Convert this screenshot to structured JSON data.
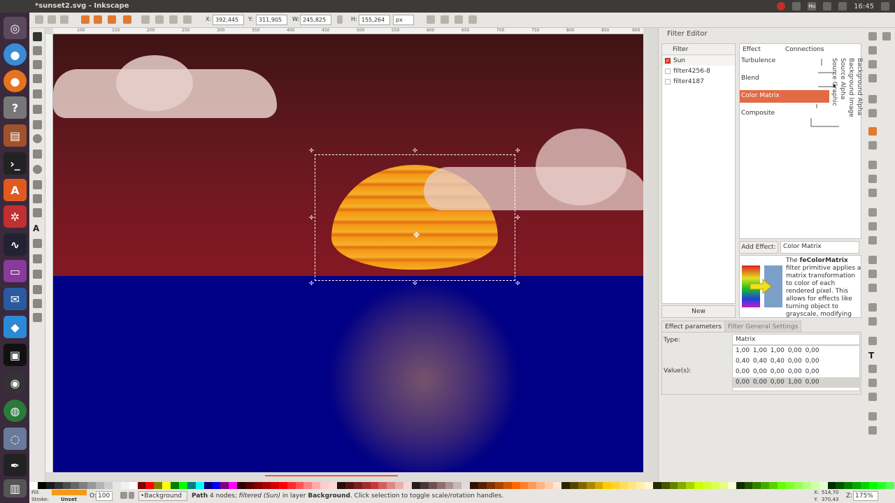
{
  "window": {
    "title": "*sunset2.svg - Inkscape"
  },
  "system_tray": {
    "time": "16:45",
    "keyboard_indicator": "Hu"
  },
  "toolbar": {
    "x_label": "X:",
    "x_value": "392,445",
    "y_label": "Y:",
    "y_value": "311,905",
    "w_label": "W:",
    "w_value": "245,825",
    "h_label": "H:",
    "h_value": "155,264",
    "units": "px"
  },
  "ruler": {
    "marks": [
      "100",
      "150",
      "200",
      "250",
      "300",
      "350",
      "400",
      "450",
      "500",
      "550",
      "600",
      "650",
      "700",
      "750",
      "800",
      "850",
      "900"
    ]
  },
  "filter_editor": {
    "title": "Filter Editor",
    "filter_column_header": "Filter",
    "filters": [
      {
        "name": "Sun",
        "checked": true
      },
      {
        "name": "filter4256-8",
        "checked": false
      },
      {
        "name": "filter4187",
        "checked": false
      }
    ],
    "new_button": "New",
    "effect_column_header": "Effect",
    "connections_column_header": "Connections",
    "effects": [
      "Turbulence",
      "Blend",
      "Color Matrix",
      "Composite"
    ],
    "selected_effect": "Color Matrix",
    "input_labels": [
      "Source Graphic",
      "Source Alpha",
      "Background Image",
      "Background Alpha"
    ],
    "add_effect_label": "Add Effect:",
    "add_effect_value": "Color Matrix",
    "description_bold": "feColorMatrix",
    "description_pre": "The ",
    "description_rest": " filter primitive applies a matrix transformation to color of each rendered pixel. This allows for effects like turning object to grayscale, modifying color saturation and changing color hue.",
    "tabs": [
      "Effect parameters",
      "Filter General Settings"
    ],
    "type_label": "Type:",
    "type_value": "Matrix",
    "values_label": "Value(s):",
    "matrix_rows": [
      "1,00 1,00 1,00 0,00 0,00",
      "0,40 0,40 0,40 0,00 0,00",
      "0,00 0,00 0,00 0,00 0,00",
      "0,00 0,00 0,00 1,00 0,00"
    ]
  },
  "status_bar": {
    "fill_label": "Fill:",
    "stroke_label": "Stroke:",
    "stroke_value": "Unset",
    "opacity_label": "O:",
    "opacity_value": "100",
    "layer_value": "•Background",
    "message_bold1": "Path",
    "message_part1": " 4 nodes; ",
    "message_italic": "filtered (Sun)",
    "message_part2": " in layer ",
    "message_bold2": "Background",
    "message_part3": ". Click selection to toggle scale/rotation handles.",
    "coord_x_label": "X:",
    "coord_x": "514,70",
    "coord_y_label": "Y:",
    "coord_y": "370,43",
    "zoom_label": "Z:",
    "zoom_value": "175%"
  },
  "colors": {
    "accent": "#e26a45",
    "fill_swatch": "#f49a18",
    "sky": "#851822",
    "sea": "#000086"
  }
}
